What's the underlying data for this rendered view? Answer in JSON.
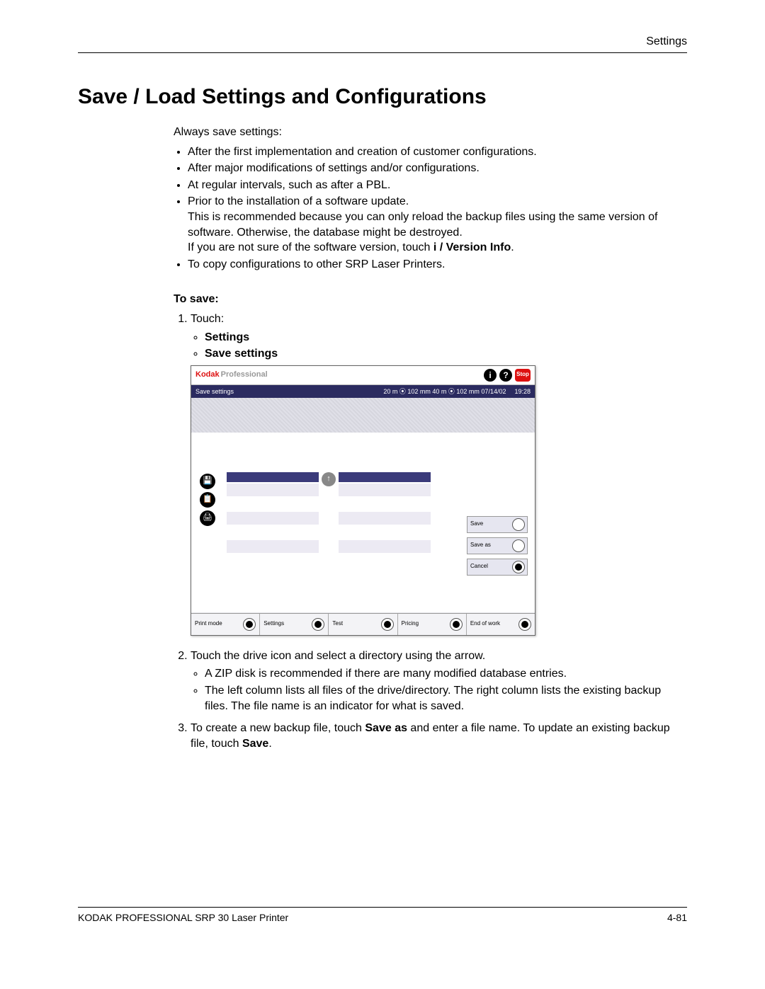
{
  "header": {
    "section": "Settings"
  },
  "title": "Save / Load Settings and Configurations",
  "intro": "Always save settings:",
  "bullets": [
    "After the first implementation and creation of customer configurations.",
    "After major modifications of settings and/or configurations.",
    "At regular intervals, such as after a PBL.",
    "Prior to the installation of a software update."
  ],
  "bullet4_sub1": "This is recommended because you can only reload the backup files using the same version of software. Otherwise, the database might be destroyed.",
  "bullet4_sub2_a": "If you are not sure of the software version, touch ",
  "bullet4_sub2_b": "i / Version Info",
  "bullet4_sub2_c": ".",
  "bullet5": "To copy configurations to other SRP Laser Printers.",
  "to_save_label": "To save:",
  "step1": "Touch:",
  "step1_items": [
    "Settings",
    "Save settings"
  ],
  "step2_a": "Touch the drive icon and select a directory using the arrow.",
  "step2_b1": "A ZIP disk is recommended if there are many modified database entries.",
  "step2_b2": "The left column lists all files of the drive/directory. The right column lists the existing backup files. The file name is an indicator for what is saved.",
  "step3_a": "To create a new backup file, touch ",
  "step3_b": "Save as",
  "step3_c": " and enter a file name. To update an existing backup file, touch ",
  "step3_d": "Save",
  "step3_e": ".",
  "shot": {
    "brand1": "Kodak",
    "brand2": "Professional",
    "info": "i",
    "help": "?",
    "stop": "Stop",
    "subtitle": "Save settings",
    "status": "20 m ⦿ 102 mm   40 m ⦿ 102 mm  07/14/02",
    "time": "19:28",
    "up": "↑",
    "side_icons": [
      "💾",
      "📋",
      "🖨"
    ],
    "right_buttons": [
      {
        "label": "Save",
        "filled": false
      },
      {
        "label": "Save as",
        "filled": false
      },
      {
        "label": "Cancel",
        "filled": true
      }
    ],
    "bottom_buttons": [
      "Print mode",
      "Settings",
      "Test",
      "Pricing",
      "End of work"
    ]
  },
  "footer": {
    "left": "KODAK PROFESSIONAL SRP 30 Laser Printer",
    "right": "4-81"
  }
}
